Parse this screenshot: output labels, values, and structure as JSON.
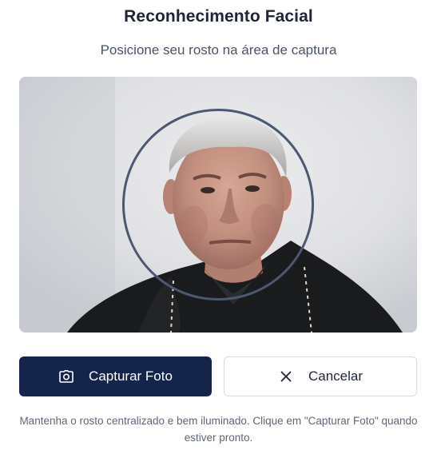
{
  "dialog": {
    "title": "Reconhecimento Facial",
    "subtitle": "Posicione seu rosto na área de captura",
    "hint": "Mantenha o rosto centralizado e bem iluminado. Clique em \"Capturar Foto\" quando estiver pronto."
  },
  "camera": {
    "feed": "live-camera-feed",
    "guide": "face-guide-circle"
  },
  "actions": {
    "capture_label": "Capturar Foto",
    "capture_icon": "camera-icon",
    "cancel_label": "Cancelar",
    "cancel_icon": "close-icon"
  },
  "colors": {
    "primary": "#14244a",
    "guide_ring": "#4a5870",
    "title": "#1f2533",
    "muted_text": "#5f6775"
  }
}
